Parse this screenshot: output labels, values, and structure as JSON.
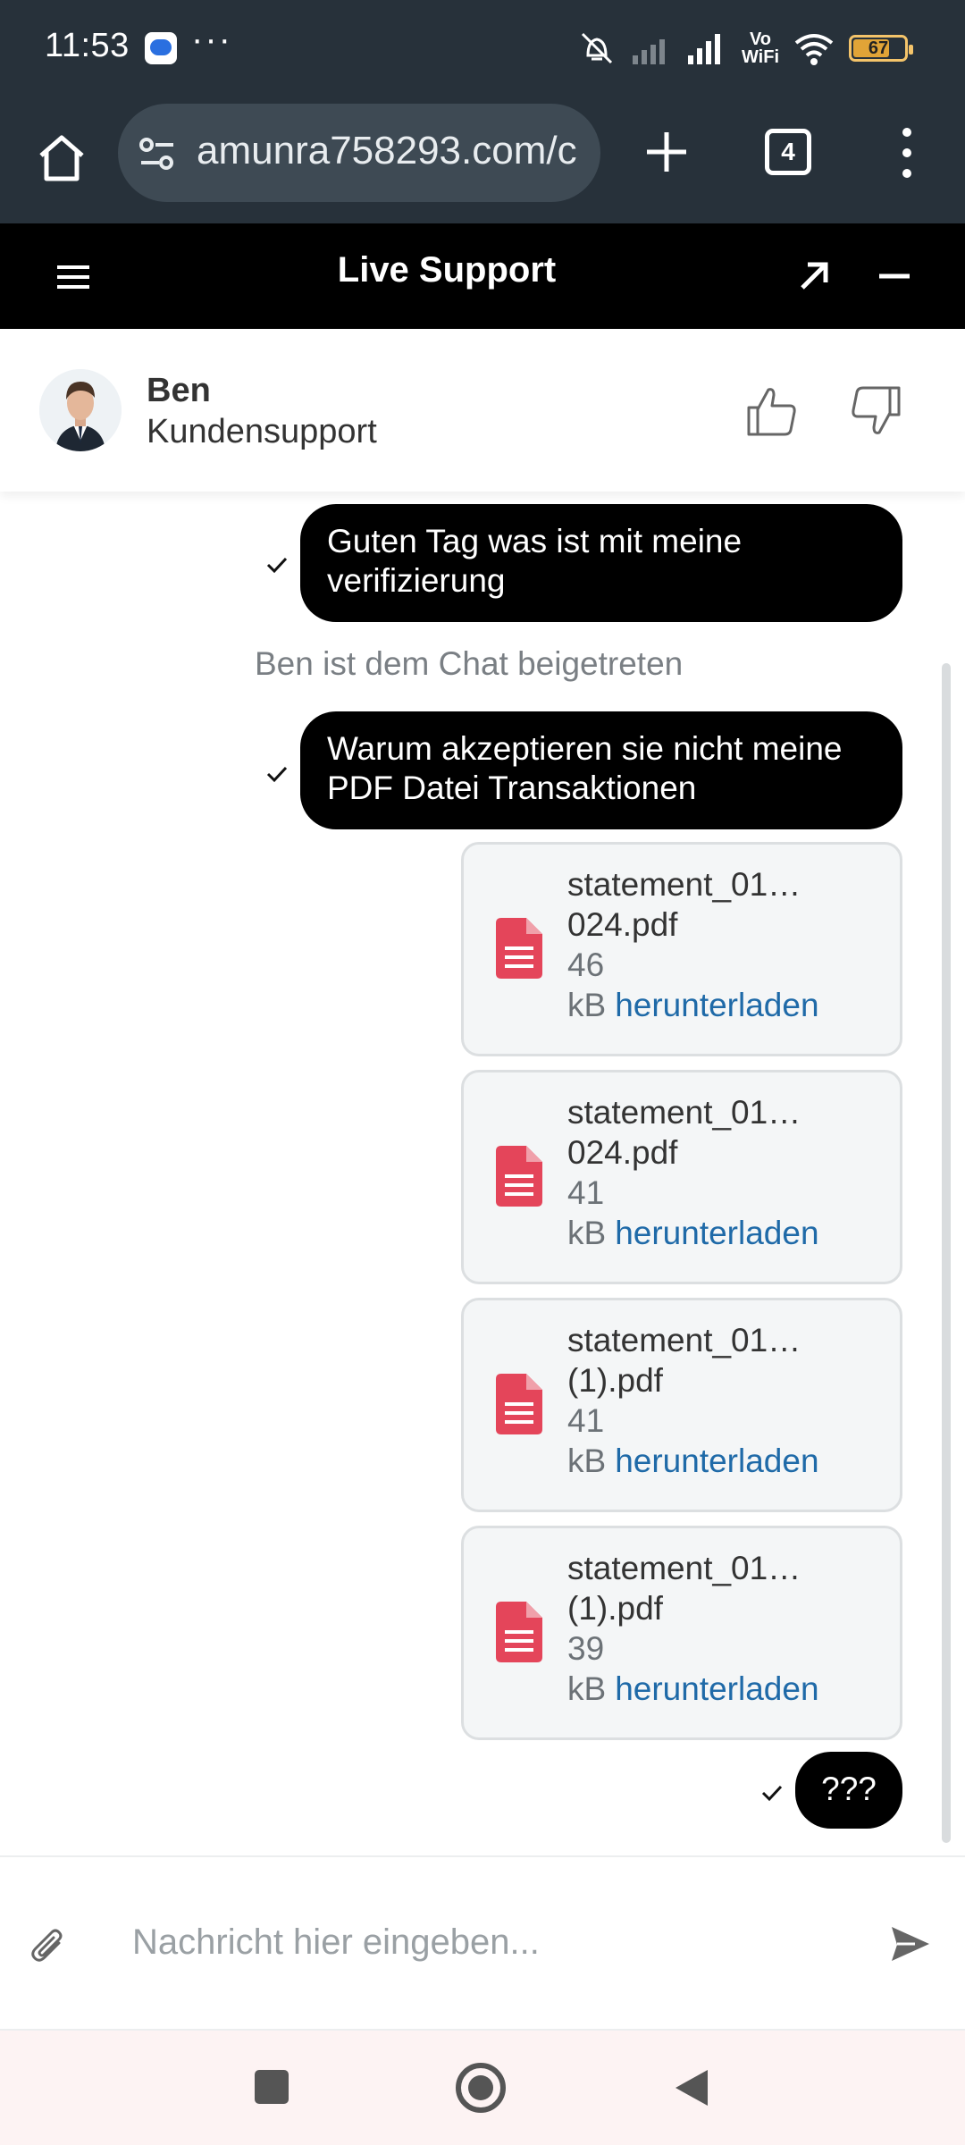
{
  "status_bar": {
    "time": "11:53",
    "more": "···",
    "vo": "Vo",
    "wifi_label": "WiFi",
    "battery": "67"
  },
  "browser": {
    "url": "amunra758293.com/c",
    "tab_count": "4"
  },
  "header": {
    "title": "Live Support"
  },
  "agent": {
    "name": "Ben",
    "role": "Kundensupport"
  },
  "chat": {
    "messages": [
      {
        "line1": "Guten Tag was ist mit meine",
        "line2": "verifizierung"
      },
      {
        "line1": "Warum akzeptieren sie nicht meine",
        "line2": "PDF Datei Transaktionen"
      },
      {
        "text": "???"
      }
    ],
    "system": "Ben ist dem Chat beigetreten",
    "files": [
      {
        "name1": "statement_01…",
        "name2": "024.pdf",
        "size": "46",
        "unit": "kB",
        "download": "herunterladen"
      },
      {
        "name1": "statement_01…",
        "name2": "024.pdf",
        "size": "41",
        "unit": "kB",
        "download": "herunterladen"
      },
      {
        "name1": "statement_01…",
        "name2": "(1).pdf",
        "size": "41",
        "unit": "kB",
        "download": "herunterladen"
      },
      {
        "name1": "statement_01…",
        "name2": "(1).pdf",
        "size": "39",
        "unit": "kB",
        "download": "herunterladen"
      }
    ]
  },
  "composer": {
    "placeholder": "Nachricht hier eingeben..."
  },
  "colors": {
    "header_bg": "#000000",
    "bubble_bg": "#000000",
    "file_icon": "#e4455a",
    "link": "#1f6aa8",
    "system_bar": "#27313a"
  }
}
